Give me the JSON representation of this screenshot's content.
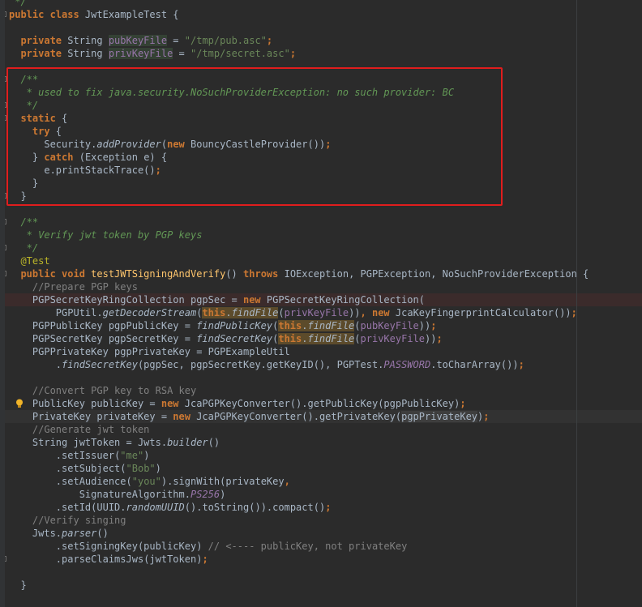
{
  "editor": {
    "lines": [
      {
        "segments": [
          {
            "t": " */",
            "c": "doc"
          }
        ]
      },
      {
        "segments": [
          {
            "t": "public class ",
            "c": "kw"
          },
          {
            "t": "JwtExampleTest",
            "c": ""
          },
          {
            "t": " {",
            "c": ""
          }
        ]
      },
      {
        "segments": [
          {
            "t": "",
            "c": ""
          }
        ]
      },
      {
        "segments": [
          {
            "t": "  private ",
            "c": "kw"
          },
          {
            "t": "String ",
            "c": ""
          },
          {
            "t": "pubKeyFile",
            "c": "fld hl-var"
          },
          {
            "t": " = ",
            "c": ""
          },
          {
            "t": "\"/tmp/pub.asc\"",
            "c": "str"
          },
          {
            "t": ";",
            "c": "kw"
          }
        ]
      },
      {
        "segments": [
          {
            "t": "  private ",
            "c": "kw"
          },
          {
            "t": "String ",
            "c": ""
          },
          {
            "t": "privKeyFile",
            "c": "fld hl-var"
          },
          {
            "t": " = ",
            "c": ""
          },
          {
            "t": "\"/tmp/secret.asc\"",
            "c": "str"
          },
          {
            "t": ";",
            "c": "kw"
          }
        ]
      },
      {
        "segments": [
          {
            "t": "",
            "c": ""
          }
        ]
      },
      {
        "segments": [
          {
            "t": "  /**",
            "c": "doc"
          }
        ]
      },
      {
        "segments": [
          {
            "t": "   * used to fix java.security.NoSuchProviderException: no such provider: BC",
            "c": "doc"
          }
        ]
      },
      {
        "segments": [
          {
            "t": "   */",
            "c": "doc"
          }
        ]
      },
      {
        "segments": [
          {
            "t": "  static ",
            "c": "kw"
          },
          {
            "t": "{",
            "c": ""
          }
        ]
      },
      {
        "segments": [
          {
            "t": "    try ",
            "c": "kw"
          },
          {
            "t": "{",
            "c": ""
          }
        ]
      },
      {
        "segments": [
          {
            "t": "      Security.",
            "c": ""
          },
          {
            "t": "addProvider",
            "c": "stat-i"
          },
          {
            "t": "(",
            "c": ""
          },
          {
            "t": "new ",
            "c": "kw"
          },
          {
            "t": "BouncyCastleProvider",
            "c": ""
          },
          {
            "t": "())",
            "c": ""
          },
          {
            "t": ";",
            "c": "kw"
          }
        ]
      },
      {
        "segments": [
          {
            "t": "    } ",
            "c": ""
          },
          {
            "t": "catch ",
            "c": "kw"
          },
          {
            "t": "(Exception e) {",
            "c": ""
          }
        ]
      },
      {
        "segments": [
          {
            "t": "      e.",
            "c": ""
          },
          {
            "t": "printStackTrace",
            "c": ""
          },
          {
            "t": "()",
            "c": ""
          },
          {
            "t": ";",
            "c": "kw"
          }
        ]
      },
      {
        "segments": [
          {
            "t": "    }",
            "c": ""
          }
        ]
      },
      {
        "segments": [
          {
            "t": "  }",
            "c": ""
          }
        ]
      },
      {
        "segments": [
          {
            "t": "",
            "c": ""
          }
        ]
      },
      {
        "segments": [
          {
            "t": "  /**",
            "c": "doc"
          }
        ]
      },
      {
        "segments": [
          {
            "t": "   * Verify jwt token by PGP keys",
            "c": "doc"
          }
        ]
      },
      {
        "segments": [
          {
            "t": "   */",
            "c": "doc"
          }
        ]
      },
      {
        "segments": [
          {
            "t": "  @Test",
            "c": "ann"
          }
        ]
      },
      {
        "segments": [
          {
            "t": "  public void ",
            "c": "kw"
          },
          {
            "t": "testJWTSigningAndVerify",
            "c": "mth"
          },
          {
            "t": "() ",
            "c": ""
          },
          {
            "t": "throws ",
            "c": "kw"
          },
          {
            "t": "IOException, PGPException, NoSuchProviderException {",
            "c": ""
          }
        ]
      },
      {
        "segments": [
          {
            "t": "    //Prepare PGP keys",
            "c": "cmt"
          }
        ]
      },
      {
        "segments": [
          {
            "t": "    PGPSecretKeyRingCollection pgpSec = ",
            "c": ""
          },
          {
            "t": "new ",
            "c": "kw"
          },
          {
            "t": "PGPSecretKeyRingCollection(",
            "c": ""
          }
        ]
      },
      {
        "segments": [
          {
            "t": "        PGPUtil.",
            "c": ""
          },
          {
            "t": "getDecoderStream",
            "c": "stat-i"
          },
          {
            "t": "(",
            "c": ""
          },
          {
            "t": "this",
            "c": "kw hl-this"
          },
          {
            "t": ".",
            "c": "hl-this"
          },
          {
            "t": "findFile",
            "c": "stat-i hl-this"
          },
          {
            "t": "(",
            "c": ""
          },
          {
            "t": "privKeyFile",
            "c": "fld"
          },
          {
            "t": "))",
            "c": ""
          },
          {
            "t": ", ",
            "c": "kw"
          },
          {
            "t": "new ",
            "c": "kw"
          },
          {
            "t": "JcaKeyFingerprintCalculator",
            "c": ""
          },
          {
            "t": "())",
            "c": ""
          },
          {
            "t": ";",
            "c": "kw"
          }
        ]
      },
      {
        "segments": [
          {
            "t": "    PGPPublicKey pgpPublicKey = ",
            "c": ""
          },
          {
            "t": "findPublicKey",
            "c": "stat-i"
          },
          {
            "t": "(",
            "c": ""
          },
          {
            "t": "this",
            "c": "kw hl-this"
          },
          {
            "t": ".",
            "c": "hl-this"
          },
          {
            "t": "findFile",
            "c": "stat-i hl-this"
          },
          {
            "t": "(",
            "c": ""
          },
          {
            "t": "pubKeyFile",
            "c": "fld"
          },
          {
            "t": "))",
            "c": ""
          },
          {
            "t": ";",
            "c": "kw"
          }
        ]
      },
      {
        "segments": [
          {
            "t": "    PGPSecretKey pgpSecretKey = ",
            "c": ""
          },
          {
            "t": "findSecretKey",
            "c": "stat-i"
          },
          {
            "t": "(",
            "c": ""
          },
          {
            "t": "this",
            "c": "kw hl-this"
          },
          {
            "t": ".",
            "c": "hl-this"
          },
          {
            "t": "findFile",
            "c": "stat-i hl-this"
          },
          {
            "t": "(",
            "c": ""
          },
          {
            "t": "privKeyFile",
            "c": "fld"
          },
          {
            "t": "))",
            "c": ""
          },
          {
            "t": ";",
            "c": "kw"
          }
        ]
      },
      {
        "segments": [
          {
            "t": "    PGPPrivateKey pgpPrivateKey = PGPExampleUtil",
            "c": ""
          }
        ]
      },
      {
        "segments": [
          {
            "t": "        .",
            "c": ""
          },
          {
            "t": "findSecretKey",
            "c": "stat-i"
          },
          {
            "t": "(pgpSec, pgpSecretKey.",
            "c": ""
          },
          {
            "t": "getKeyID",
            "c": ""
          },
          {
            "t": "(), PGPTest.",
            "c": ""
          },
          {
            "t": "PASSWORD",
            "c": "fld-i"
          },
          {
            "t": ".",
            "c": ""
          },
          {
            "t": "toCharArray",
            "c": ""
          },
          {
            "t": "())",
            "c": ""
          },
          {
            "t": ";",
            "c": "kw"
          }
        ]
      },
      {
        "segments": [
          {
            "t": "",
            "c": ""
          }
        ]
      },
      {
        "segments": [
          {
            "t": "    //Convert PGP key to RSA key",
            "c": "cmt"
          }
        ]
      },
      {
        "segments": [
          {
            "t": "    PublicKey publicKey = ",
            "c": ""
          },
          {
            "t": "new ",
            "c": "kw"
          },
          {
            "t": "JcaPGPKeyConverter",
            "c": ""
          },
          {
            "t": "().",
            "c": ""
          },
          {
            "t": "getPublicKey",
            "c": ""
          },
          {
            "t": "(pgpPublicKey)",
            "c": ""
          },
          {
            "t": ";",
            "c": "kw"
          }
        ]
      },
      {
        "segments": [
          {
            "t": "    PrivateKey privateKey = ",
            "c": ""
          },
          {
            "t": "new ",
            "c": "kw"
          },
          {
            "t": "JcaPGPKeyConverter",
            "c": ""
          },
          {
            "t": "().",
            "c": ""
          },
          {
            "t": "getPrivateKey",
            "c": ""
          },
          {
            "t": "(",
            "c": ""
          },
          {
            "t": "pgpPrivateKey",
            "c": "hl-ref"
          },
          {
            "t": ")",
            "c": ""
          },
          {
            "t": ";",
            "c": "kw"
          }
        ]
      },
      {
        "segments": [
          {
            "t": "    //Generate jwt token",
            "c": "cmt"
          }
        ]
      },
      {
        "segments": [
          {
            "t": "    String jwtToken = Jwts.",
            "c": ""
          },
          {
            "t": "builder",
            "c": "stat-i"
          },
          {
            "t": "()",
            "c": ""
          }
        ]
      },
      {
        "segments": [
          {
            "t": "        .",
            "c": ""
          },
          {
            "t": "setIssuer",
            "c": ""
          },
          {
            "t": "(",
            "c": ""
          },
          {
            "t": "\"me\"",
            "c": "str"
          },
          {
            "t": ")",
            "c": ""
          }
        ]
      },
      {
        "segments": [
          {
            "t": "        .",
            "c": ""
          },
          {
            "t": "setSubject",
            "c": ""
          },
          {
            "t": "(",
            "c": ""
          },
          {
            "t": "\"Bob\"",
            "c": "str"
          },
          {
            "t": ")",
            "c": ""
          }
        ]
      },
      {
        "segments": [
          {
            "t": "        .",
            "c": ""
          },
          {
            "t": "setAudience",
            "c": ""
          },
          {
            "t": "(",
            "c": ""
          },
          {
            "t": "\"you\"",
            "c": "str"
          },
          {
            "t": ").",
            "c": ""
          },
          {
            "t": "signWith",
            "c": ""
          },
          {
            "t": "(privateKey",
            "c": ""
          },
          {
            "t": ",",
            "c": "kw"
          }
        ]
      },
      {
        "segments": [
          {
            "t": "            SignatureAlgorithm.",
            "c": ""
          },
          {
            "t": "PS256",
            "c": "fld-i"
          },
          {
            "t": ")",
            "c": ""
          }
        ]
      },
      {
        "segments": [
          {
            "t": "        .",
            "c": ""
          },
          {
            "t": "setId",
            "c": ""
          },
          {
            "t": "(UUID.",
            "c": ""
          },
          {
            "t": "randomUUID",
            "c": "stat-i"
          },
          {
            "t": "().",
            "c": ""
          },
          {
            "t": "toString",
            "c": ""
          },
          {
            "t": "()).",
            "c": ""
          },
          {
            "t": "compact",
            "c": ""
          },
          {
            "t": "()",
            "c": ""
          },
          {
            "t": ";",
            "c": "kw"
          }
        ]
      },
      {
        "segments": [
          {
            "t": "    //Verify singing",
            "c": "cmt"
          }
        ]
      },
      {
        "segments": [
          {
            "t": "    Jwts.",
            "c": ""
          },
          {
            "t": "parser",
            "c": "stat-i"
          },
          {
            "t": "()",
            "c": ""
          }
        ]
      },
      {
        "segments": [
          {
            "t": "        .",
            "c": ""
          },
          {
            "t": "setSigningKey",
            "c": ""
          },
          {
            "t": "(publicKey) ",
            "c": ""
          },
          {
            "t": "// <---- publicKey, not privateKey",
            "c": "cmt"
          }
        ]
      },
      {
        "segments": [
          {
            "t": "        .",
            "c": ""
          },
          {
            "t": "parseClaimsJws",
            "c": ""
          },
          {
            "t": "(jwtToken)",
            "c": ""
          },
          {
            "t": ";",
            "c": "kw"
          }
        ]
      },
      {
        "segments": [
          {
            "t": "",
            "c": ""
          }
        ]
      },
      {
        "segments": [
          {
            "t": "  }",
            "c": ""
          }
        ]
      }
    ]
  },
  "colors": {
    "background": "#2b2b2b",
    "keyword": "#cc7832",
    "string": "#6a8759",
    "comment": "#808080",
    "doc_comment": "#629755",
    "field": "#9876aa",
    "annotation": "#bbb529",
    "method_decl": "#ffc66d",
    "highlight_box": "#e01d1d"
  }
}
